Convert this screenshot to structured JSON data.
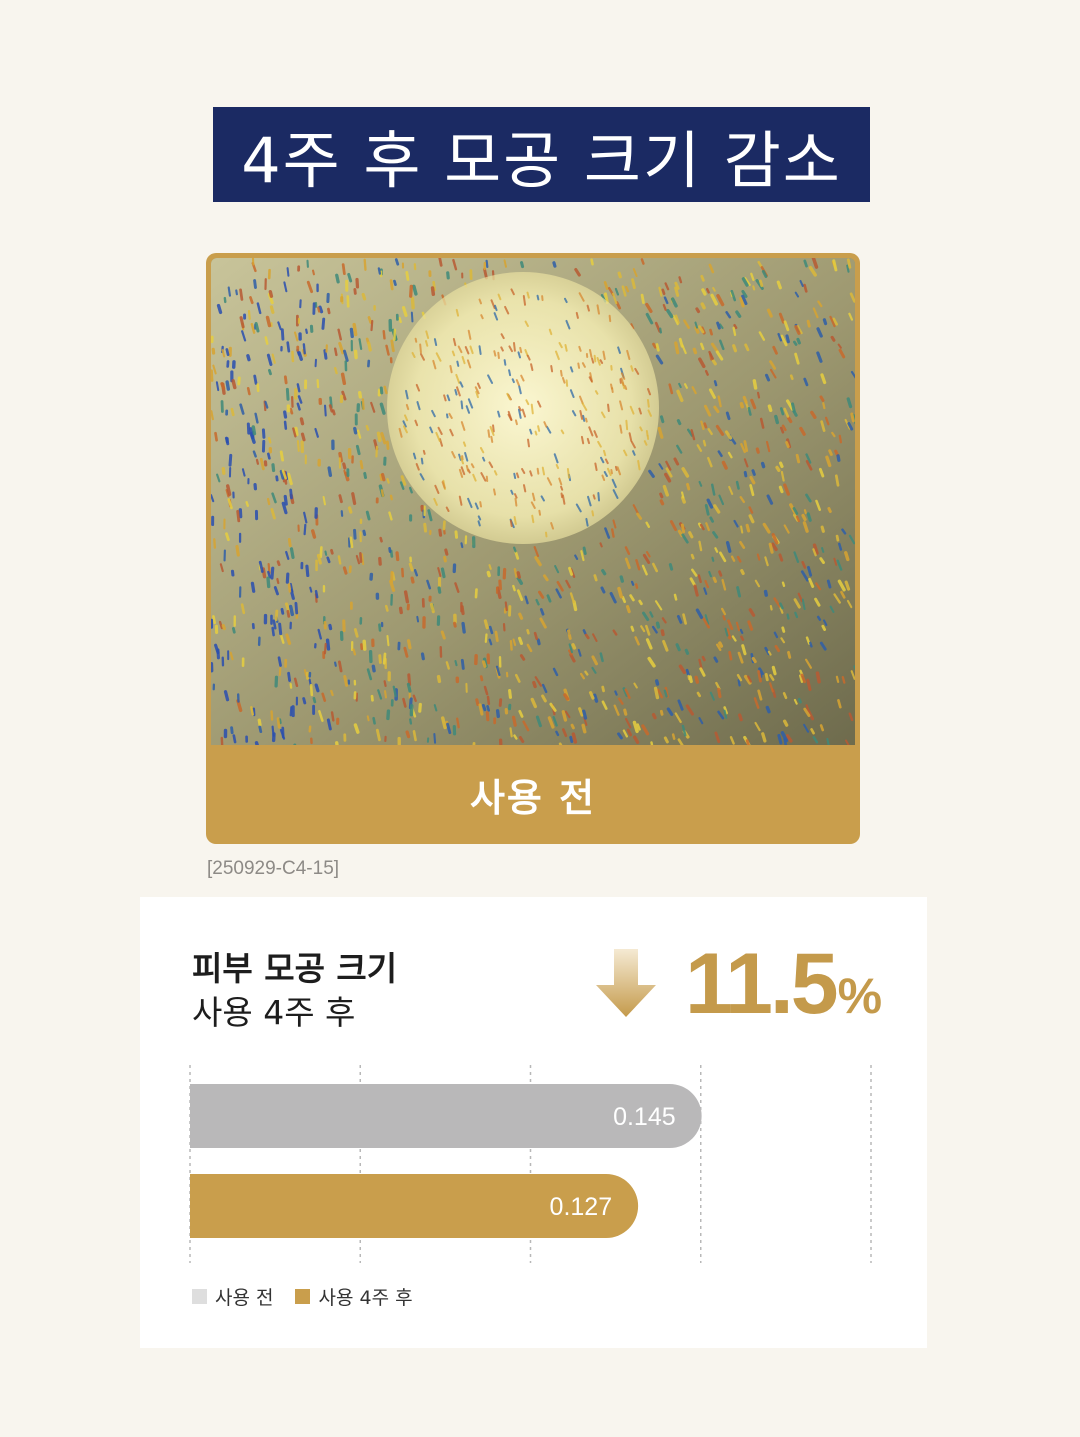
{
  "banner": {
    "title": "4주 후 모공 크기 감소"
  },
  "photo": {
    "caption": "사용 전",
    "code": "[250929-C4-15]"
  },
  "metric": {
    "title": "피부 모공 크기",
    "subtitle": "사용 4주 후",
    "change_value": "11.5",
    "change_unit": "%",
    "arrow_icon": "down-arrow-icon"
  },
  "colors": {
    "navy": "#1b2a63",
    "gold": "#c99e4c",
    "gray": "#b9b8b9",
    "background": "#f8f5ee"
  },
  "chart_data": {
    "type": "bar",
    "orientation": "horizontal",
    "categories": [
      "사용 전",
      "사용 4주 후"
    ],
    "series": [
      {
        "name": "사용 전",
        "values": [
          0.145,
          null
        ],
        "color": "#b9b8b9",
        "label": "0.145"
      },
      {
        "name": "사용 4주 후",
        "values": [
          null,
          0.127
        ],
        "color": "#c99e4c",
        "label": "0.127"
      }
    ],
    "xlim": [
      0,
      0.193
    ],
    "grid": true,
    "legend": "bottom-left"
  }
}
